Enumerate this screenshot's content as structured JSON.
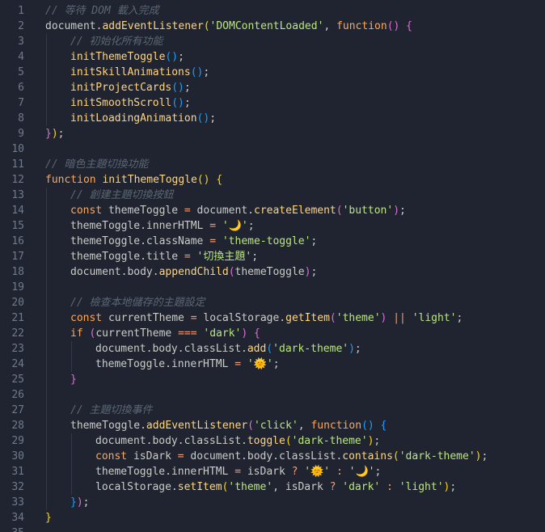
{
  "editor": {
    "line_numbers": [
      "1",
      "2",
      "3",
      "4",
      "5",
      "6",
      "7",
      "8",
      "9",
      "10",
      "11",
      "12",
      "13",
      "14",
      "15",
      "16",
      "17",
      "18",
      "19",
      "20",
      "21",
      "22",
      "23",
      "24",
      "25",
      "26",
      "27",
      "28",
      "29",
      "30",
      "31",
      "32",
      "33",
      "34",
      "35"
    ],
    "lines": [
      {
        "indent": 0,
        "tokens": [
          {
            "t": "// 等待 DOM 載入完成",
            "c": "c-comment"
          }
        ]
      },
      {
        "indent": 0,
        "tokens": [
          {
            "t": "document",
            "c": "c-obj"
          },
          {
            "t": ".",
            "c": "c-obj"
          },
          {
            "t": "addEventListener",
            "c": "c-method"
          },
          {
            "t": "(",
            "c": "c-p1"
          },
          {
            "t": "'DOMContentLoaded'",
            "c": "c-str"
          },
          {
            "t": ", ",
            "c": "c-obj"
          },
          {
            "t": "function",
            "c": "c-kw"
          },
          {
            "t": "() ",
            "c": "c-p2"
          },
          {
            "t": "{",
            "c": "c-p2"
          }
        ]
      },
      {
        "indent": 1,
        "tokens": [
          {
            "t": "// 初始化所有功能",
            "c": "c-comment"
          }
        ]
      },
      {
        "indent": 1,
        "tokens": [
          {
            "t": "initThemeToggle",
            "c": "c-fn"
          },
          {
            "t": "()",
            "c": "c-p3"
          },
          {
            "t": ";",
            "c": "c-obj"
          }
        ]
      },
      {
        "indent": 1,
        "tokens": [
          {
            "t": "initSkillAnimations",
            "c": "c-fn"
          },
          {
            "t": "()",
            "c": "c-p3"
          },
          {
            "t": ";",
            "c": "c-obj"
          }
        ]
      },
      {
        "indent": 1,
        "tokens": [
          {
            "t": "initProjectCards",
            "c": "c-fn"
          },
          {
            "t": "()",
            "c": "c-p3"
          },
          {
            "t": ";",
            "c": "c-obj"
          }
        ]
      },
      {
        "indent": 1,
        "tokens": [
          {
            "t": "initSmoothScroll",
            "c": "c-fn"
          },
          {
            "t": "()",
            "c": "c-p3"
          },
          {
            "t": ";",
            "c": "c-obj"
          }
        ]
      },
      {
        "indent": 1,
        "tokens": [
          {
            "t": "initLoadingAnimation",
            "c": "c-fn"
          },
          {
            "t": "()",
            "c": "c-p3"
          },
          {
            "t": ";",
            "c": "c-obj"
          }
        ]
      },
      {
        "indent": 0,
        "tokens": [
          {
            "t": "}",
            "c": "c-p2"
          },
          {
            "t": ")",
            "c": "c-p1"
          },
          {
            "t": ";",
            "c": "c-obj"
          }
        ]
      },
      {
        "indent": 0,
        "tokens": []
      },
      {
        "indent": 0,
        "tokens": [
          {
            "t": "// 暗色主題切換功能",
            "c": "c-comment"
          }
        ]
      },
      {
        "indent": 0,
        "tokens": [
          {
            "t": "function ",
            "c": "c-kw"
          },
          {
            "t": "initThemeToggle",
            "c": "c-fn"
          },
          {
            "t": "() ",
            "c": "c-p1"
          },
          {
            "t": "{",
            "c": "c-p1"
          }
        ]
      },
      {
        "indent": 1,
        "tokens": [
          {
            "t": "// 創建主題切換按鈕",
            "c": "c-comment"
          }
        ]
      },
      {
        "indent": 1,
        "tokens": [
          {
            "t": "const ",
            "c": "c-kw"
          },
          {
            "t": "themeToggle ",
            "c": "c-obj"
          },
          {
            "t": "= ",
            "c": "c-op"
          },
          {
            "t": "document",
            "c": "c-obj"
          },
          {
            "t": ".",
            "c": "c-obj"
          },
          {
            "t": "createElement",
            "c": "c-method"
          },
          {
            "t": "(",
            "c": "c-p2"
          },
          {
            "t": "'button'",
            "c": "c-str"
          },
          {
            "t": ")",
            "c": "c-p2"
          },
          {
            "t": ";",
            "c": "c-obj"
          }
        ]
      },
      {
        "indent": 1,
        "tokens": [
          {
            "t": "themeToggle",
            "c": "c-obj"
          },
          {
            "t": ".innerHTML ",
            "c": "c-obj"
          },
          {
            "t": "= ",
            "c": "c-op"
          },
          {
            "t": "'🌙'",
            "c": "c-str"
          },
          {
            "t": ";",
            "c": "c-obj"
          }
        ]
      },
      {
        "indent": 1,
        "tokens": [
          {
            "t": "themeToggle",
            "c": "c-obj"
          },
          {
            "t": ".className ",
            "c": "c-obj"
          },
          {
            "t": "= ",
            "c": "c-op"
          },
          {
            "t": "'theme-toggle'",
            "c": "c-str"
          },
          {
            "t": ";",
            "c": "c-obj"
          }
        ]
      },
      {
        "indent": 1,
        "tokens": [
          {
            "t": "themeToggle",
            "c": "c-obj"
          },
          {
            "t": ".title ",
            "c": "c-obj"
          },
          {
            "t": "= ",
            "c": "c-op"
          },
          {
            "t": "'切換主題'",
            "c": "c-str"
          },
          {
            "t": ";",
            "c": "c-obj"
          }
        ]
      },
      {
        "indent": 1,
        "tokens": [
          {
            "t": "document",
            "c": "c-obj"
          },
          {
            "t": ".body.",
            "c": "c-obj"
          },
          {
            "t": "appendChild",
            "c": "c-method"
          },
          {
            "t": "(",
            "c": "c-p2"
          },
          {
            "t": "themeToggle",
            "c": "c-obj"
          },
          {
            "t": ")",
            "c": "c-p2"
          },
          {
            "t": ";",
            "c": "c-obj"
          }
        ]
      },
      {
        "indent": 1,
        "tokens": []
      },
      {
        "indent": 1,
        "tokens": [
          {
            "t": "// 檢查本地儲存的主題設定",
            "c": "c-comment"
          }
        ]
      },
      {
        "indent": 1,
        "tokens": [
          {
            "t": "const ",
            "c": "c-kw"
          },
          {
            "t": "currentTheme ",
            "c": "c-obj"
          },
          {
            "t": "= ",
            "c": "c-op"
          },
          {
            "t": "localStorage",
            "c": "c-obj"
          },
          {
            "t": ".",
            "c": "c-obj"
          },
          {
            "t": "getItem",
            "c": "c-method"
          },
          {
            "t": "(",
            "c": "c-p2"
          },
          {
            "t": "'theme'",
            "c": "c-str"
          },
          {
            "t": ") ",
            "c": "c-p2"
          },
          {
            "t": "|| ",
            "c": "c-op"
          },
          {
            "t": "'light'",
            "c": "c-str"
          },
          {
            "t": ";",
            "c": "c-obj"
          }
        ]
      },
      {
        "indent": 1,
        "tokens": [
          {
            "t": "if ",
            "c": "c-kw"
          },
          {
            "t": "(",
            "c": "c-p2"
          },
          {
            "t": "currentTheme ",
            "c": "c-obj"
          },
          {
            "t": "=== ",
            "c": "c-op"
          },
          {
            "t": "'dark'",
            "c": "c-str"
          },
          {
            "t": ") ",
            "c": "c-p2"
          },
          {
            "t": "{",
            "c": "c-p2"
          }
        ]
      },
      {
        "indent": 2,
        "tokens": [
          {
            "t": "document",
            "c": "c-obj"
          },
          {
            "t": ".body.classList.",
            "c": "c-obj"
          },
          {
            "t": "add",
            "c": "c-method"
          },
          {
            "t": "(",
            "c": "c-p3"
          },
          {
            "t": "'dark-theme'",
            "c": "c-str"
          },
          {
            "t": ")",
            "c": "c-p3"
          },
          {
            "t": ";",
            "c": "c-obj"
          }
        ]
      },
      {
        "indent": 2,
        "tokens": [
          {
            "t": "themeToggle",
            "c": "c-obj"
          },
          {
            "t": ".innerHTML ",
            "c": "c-obj"
          },
          {
            "t": "= ",
            "c": "c-op"
          },
          {
            "t": "'🌞'",
            "c": "c-str"
          },
          {
            "t": ";",
            "c": "c-obj"
          }
        ]
      },
      {
        "indent": 1,
        "tokens": [
          {
            "t": "}",
            "c": "c-p2"
          }
        ]
      },
      {
        "indent": 1,
        "tokens": []
      },
      {
        "indent": 1,
        "tokens": [
          {
            "t": "// 主題切換事件",
            "c": "c-comment"
          }
        ]
      },
      {
        "indent": 1,
        "tokens": [
          {
            "t": "themeToggle",
            "c": "c-obj"
          },
          {
            "t": ".",
            "c": "c-obj"
          },
          {
            "t": "addEventListener",
            "c": "c-method"
          },
          {
            "t": "(",
            "c": "c-p2"
          },
          {
            "t": "'click'",
            "c": "c-str"
          },
          {
            "t": ", ",
            "c": "c-obj"
          },
          {
            "t": "function",
            "c": "c-kw"
          },
          {
            "t": "() ",
            "c": "c-p3"
          },
          {
            "t": "{",
            "c": "c-p3"
          }
        ]
      },
      {
        "indent": 2,
        "tokens": [
          {
            "t": "document",
            "c": "c-obj"
          },
          {
            "t": ".body.classList.",
            "c": "c-obj"
          },
          {
            "t": "toggle",
            "c": "c-method"
          },
          {
            "t": "(",
            "c": "c-p1"
          },
          {
            "t": "'dark-theme'",
            "c": "c-str"
          },
          {
            "t": ")",
            "c": "c-p1"
          },
          {
            "t": ";",
            "c": "c-obj"
          }
        ]
      },
      {
        "indent": 2,
        "tokens": [
          {
            "t": "const ",
            "c": "c-kw"
          },
          {
            "t": "isDark ",
            "c": "c-obj"
          },
          {
            "t": "= ",
            "c": "c-op"
          },
          {
            "t": "document",
            "c": "c-obj"
          },
          {
            "t": ".body.classList.",
            "c": "c-obj"
          },
          {
            "t": "contains",
            "c": "c-method"
          },
          {
            "t": "(",
            "c": "c-p1"
          },
          {
            "t": "'dark-theme'",
            "c": "c-str"
          },
          {
            "t": ")",
            "c": "c-p1"
          },
          {
            "t": ";",
            "c": "c-obj"
          }
        ]
      },
      {
        "indent": 2,
        "tokens": [
          {
            "t": "themeToggle",
            "c": "c-obj"
          },
          {
            "t": ".innerHTML ",
            "c": "c-obj"
          },
          {
            "t": "= ",
            "c": "c-op"
          },
          {
            "t": "isDark ",
            "c": "c-obj"
          },
          {
            "t": "? ",
            "c": "c-op"
          },
          {
            "t": "'🌞' ",
            "c": "c-str"
          },
          {
            "t": ": ",
            "c": "c-op"
          },
          {
            "t": "'🌙'",
            "c": "c-str"
          },
          {
            "t": ";",
            "c": "c-obj"
          }
        ]
      },
      {
        "indent": 2,
        "tokens": [
          {
            "t": "localStorage",
            "c": "c-obj"
          },
          {
            "t": ".",
            "c": "c-obj"
          },
          {
            "t": "setItem",
            "c": "c-method"
          },
          {
            "t": "(",
            "c": "c-p1"
          },
          {
            "t": "'theme'",
            "c": "c-str"
          },
          {
            "t": ", ",
            "c": "c-obj"
          },
          {
            "t": "isDark ",
            "c": "c-obj"
          },
          {
            "t": "? ",
            "c": "c-op"
          },
          {
            "t": "'dark' ",
            "c": "c-str"
          },
          {
            "t": ": ",
            "c": "c-op"
          },
          {
            "t": "'light'",
            "c": "c-str"
          },
          {
            "t": ")",
            "c": "c-p1"
          },
          {
            "t": ";",
            "c": "c-obj"
          }
        ]
      },
      {
        "indent": 1,
        "tokens": [
          {
            "t": "}",
            "c": "c-p3"
          },
          {
            "t": ")",
            "c": "c-p2"
          },
          {
            "t": ";",
            "c": "c-obj"
          }
        ]
      },
      {
        "indent": 0,
        "tokens": [
          {
            "t": "}",
            "c": "c-p1"
          }
        ]
      },
      {
        "indent": 0,
        "tokens": []
      }
    ]
  }
}
